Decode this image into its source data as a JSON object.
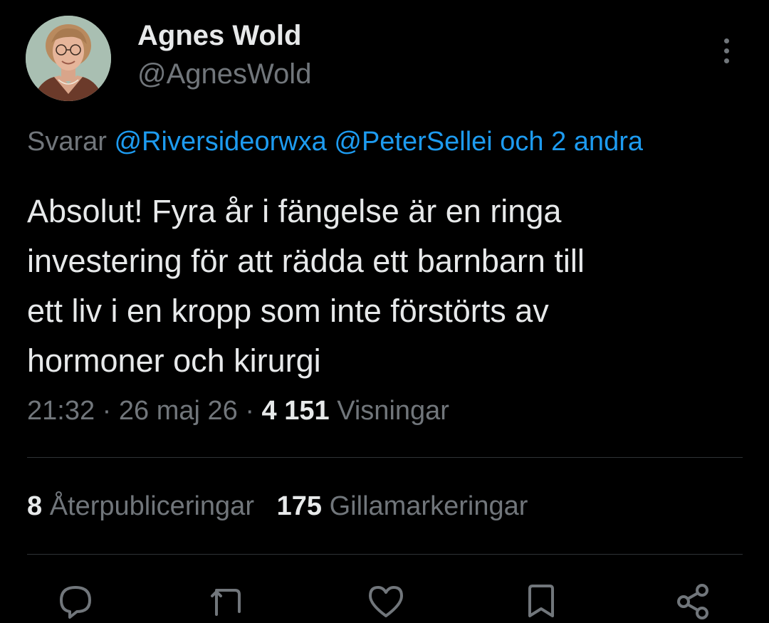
{
  "author": {
    "display_name": "Agnes Wold",
    "handle": "@AgnesWold"
  },
  "reply": {
    "prefix": "Svarar",
    "mentions": [
      "@Riversideorwxa",
      "@PeterSellei"
    ],
    "suffix": "och 2 andra"
  },
  "tweet": {
    "text": "Absolut! Fyra år i fängelse är en ringa\ninvestering för att rädda ett barnbarn till\nett liv i en kropp som inte förstörts av\nhormoner och kirurgi"
  },
  "meta": {
    "time": "21:32",
    "date": "26 maj 26",
    "views_count": "4 151",
    "views_label": "Visningar",
    "separator": "·"
  },
  "stats": {
    "retweets_count": "8",
    "retweets_label": "Återpubliceringar",
    "likes_count": "175",
    "likes_label": "Gillamarkeringar"
  },
  "icons": {
    "more": "more-vertical-icon",
    "reply": "reply-icon",
    "retweet": "retweet-icon",
    "like": "heart-icon",
    "bookmark": "bookmark-icon",
    "share": "share-icon"
  },
  "colors": {
    "background": "#000000",
    "text": "#e7e9ea",
    "secondary": "#71767b",
    "link": "#1d9bf0",
    "divider": "#2f3336"
  }
}
